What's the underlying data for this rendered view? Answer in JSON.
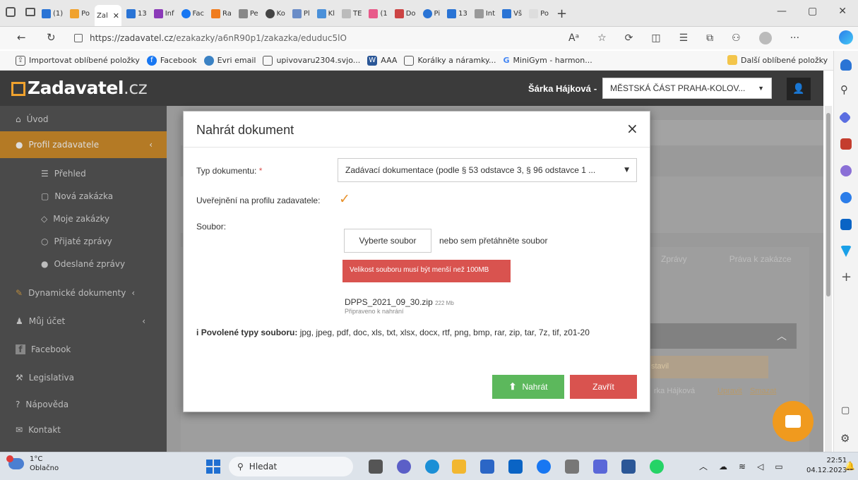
{
  "browser": {
    "tabs": [
      "(1)",
      "Po",
      "Zal",
      "13",
      "Inf",
      "Fac",
      "Ra",
      "Pe",
      "Ko",
      "Pl",
      "Kl",
      "TE",
      "(1",
      "Do",
      "Pi",
      "13",
      "Int",
      "Vš",
      "Po"
    ],
    "url_host": "https://zadavatel.cz",
    "url_path": "/ezakazky/a6nR90p1/zakazka/eduduc5lO",
    "favorites": [
      "Importovat oblíbené položky",
      "Facebook",
      "Evri email",
      "upivovaru2304.svjo...",
      "AAA",
      "Korálky a náramky...",
      "MiniGym - harmon..."
    ],
    "favorites_other": "Další oblíbené položky"
  },
  "site": {
    "logo_main": "Zadavatel",
    "logo_tld": ".cz",
    "user_name": "Šárka Hájková",
    "user_sep": "-",
    "org_selected": "MĚSTSKÁ ČÁST PRAHA-KOLOV...",
    "sidebar": [
      {
        "label": "Úvod",
        "icon": "home-icon"
      },
      {
        "label": "Profil zadavatele",
        "icon": "profile-icon"
      },
      {
        "label": "Přehled",
        "icon": "list-icon"
      },
      {
        "label": "Nová zakázka",
        "icon": "file-icon"
      },
      {
        "label": "Moje zakázky",
        "icon": "folder-icon"
      },
      {
        "label": "Přijaté zprávy",
        "icon": "inbox-icon"
      },
      {
        "label": "Odeslané zprávy",
        "icon": "send-icon"
      },
      {
        "label": "Dynamické dokumenty",
        "icon": "edit-icon"
      },
      {
        "label": "Můj účet",
        "icon": "user-icon"
      },
      {
        "label": "Facebook",
        "icon": "facebook-icon"
      },
      {
        "label": "Legislativa",
        "icon": "gavel-icon"
      },
      {
        "label": "Nápověda",
        "icon": "help-icon"
      },
      {
        "label": "Kontakt",
        "icon": "mail-icon"
      }
    ],
    "bg_tabs": [
      "Zprávy",
      "Práva k zakázce"
    ],
    "bg_status": "stavil",
    "bg_row_user": "rka Hájková",
    "bg_row_edit": "Upravit",
    "bg_row_delete": "Smazat"
  },
  "modal": {
    "title": "Nahrát dokument",
    "close": "×",
    "doc_type_label": "Typ dokumentu:",
    "required_mark": "*",
    "doc_type_value": "Zadávací dokumentace (podle § 53 odstavce 3, § 96 odstavce 1 ...",
    "published_label": "Uveřejnění na profilu zadavatele:",
    "published_checked": true,
    "file_label": "Soubor:",
    "choose_file_button": "Vyberte soubor",
    "drag_text": "nebo sem přetáhněte soubor",
    "error_text": "Velikost souboru musí být menší než 100MB",
    "file_name": "DPPS_2021_09_30.zip",
    "file_size": "222 Mb",
    "file_status": "Připraveno k nahrání",
    "allowed_icon": "i",
    "allowed_label": "Povolené typy souboru:",
    "allowed_types": "jpg, jpeg, pdf, doc, xls, txt, xlsx, docx, rtf, png, bmp, rar, zip, tar, 7z, tif, z01-20",
    "upload_button": "Nahrát",
    "close_button": "Zavřít"
  },
  "taskbar": {
    "weather_temp": "1°C",
    "weather_desc": "Oblačno",
    "search_placeholder": "Hledat",
    "time": "22:51",
    "date": "04.12.2023"
  },
  "colors": {
    "accent_orange": "#f0a22e",
    "error_red": "#d9534f",
    "success_green": "#5cb85c",
    "header_dark": "#3b3b3b"
  }
}
